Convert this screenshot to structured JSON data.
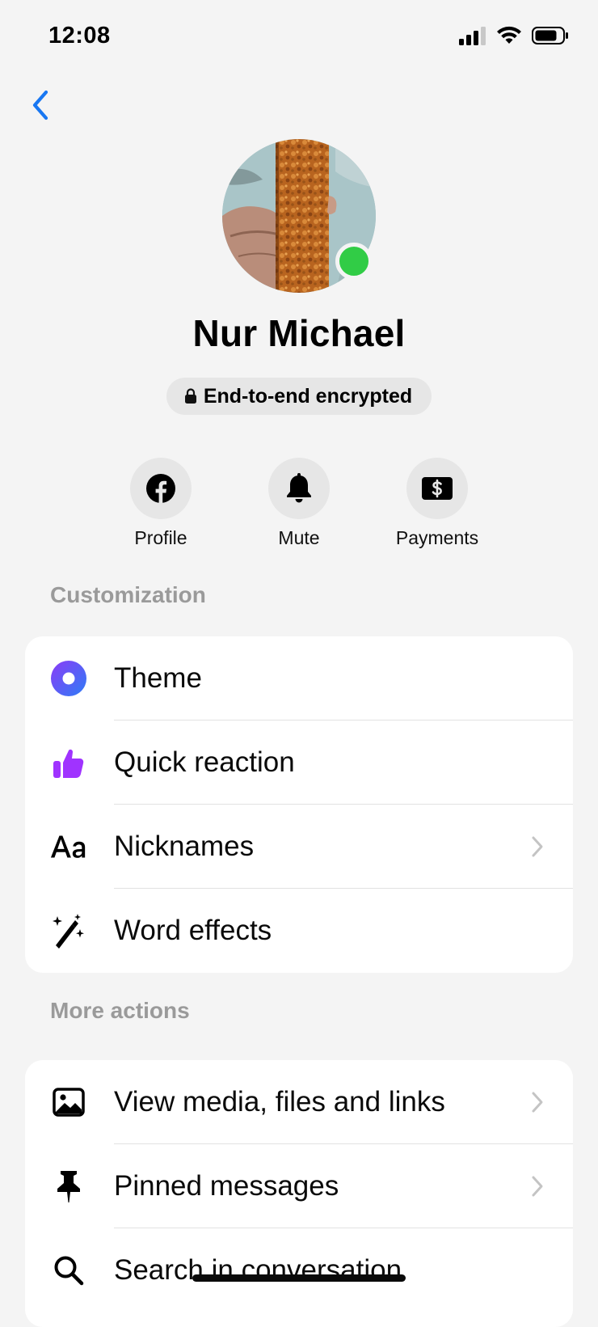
{
  "status_bar": {
    "time": "12:08"
  },
  "profile": {
    "name": "Nur Michael",
    "encryption_label": "End-to-end encrypted",
    "online": true
  },
  "quick_actions": [
    {
      "label": "Profile",
      "icon": "facebook-icon"
    },
    {
      "label": "Mute",
      "icon": "bell-icon"
    },
    {
      "label": "Payments",
      "icon": "payments-icon"
    }
  ],
  "customization": {
    "title": "Customization",
    "items": [
      {
        "label": "Theme",
        "icon": "theme-icon",
        "has_chevron": false
      },
      {
        "label": "Quick reaction",
        "icon": "thumbs-up-icon",
        "has_chevron": false
      },
      {
        "label": "Nicknames",
        "icon": "font-aa-icon",
        "has_chevron": true
      },
      {
        "label": "Word effects",
        "icon": "magic-wand-icon",
        "has_chevron": false
      }
    ]
  },
  "more_actions": {
    "title": "More actions",
    "items": [
      {
        "label": "View media, files and links",
        "icon": "image-icon",
        "has_chevron": true
      },
      {
        "label": "Pinned messages",
        "icon": "pin-icon",
        "has_chevron": true
      },
      {
        "label": "Search in conversation",
        "icon": "search-icon",
        "has_chevron": false
      }
    ]
  },
  "colors": {
    "accent": "#1877f2",
    "online": "#31cc46",
    "theme_gradient_start": "#8b3cf7",
    "theme_gradient_end": "#2e7cf6",
    "quick_reaction": "#a033ff",
    "section_title": "#9a9a9a"
  }
}
